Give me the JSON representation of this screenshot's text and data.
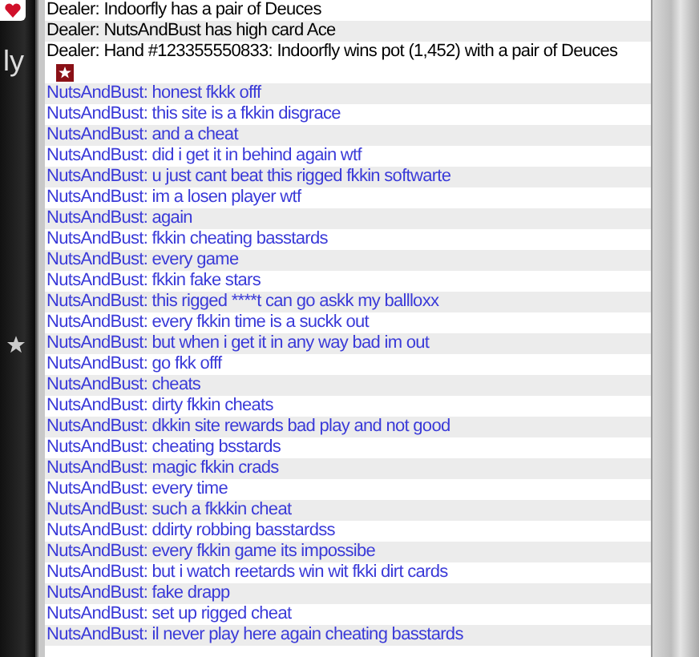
{
  "side_panel": {
    "label": "ly"
  },
  "chat": {
    "messages": [
      {
        "kind": "dealer",
        "text": "Dealer: Indoorfly has a pair of Deuces"
      },
      {
        "kind": "dealer",
        "text": "Dealer: NutsAndBust has high card Ace"
      },
      {
        "kind": "dealer",
        "text": "Dealer: Hand #123355550833: Indoorfly wins pot (1,452) with a pair of Deuces",
        "badge": true
      },
      {
        "kind": "player",
        "text": "NutsAndBust: honest fkkk offf"
      },
      {
        "kind": "player",
        "text": "NutsAndBust: this site is a fkkin disgrace"
      },
      {
        "kind": "player",
        "text": "NutsAndBust: and a  cheat"
      },
      {
        "kind": "player",
        "text": "NutsAndBust: did i get it in behind again wtf"
      },
      {
        "kind": "player",
        "text": "NutsAndBust: u just cant beat this rigged fkkin softwarte"
      },
      {
        "kind": "player",
        "text": "NutsAndBust: im  a losen player wtf"
      },
      {
        "kind": "player",
        "text": "NutsAndBust: again"
      },
      {
        "kind": "player",
        "text": "NutsAndBust: fkkin cheating basstards"
      },
      {
        "kind": "player",
        "text": "NutsAndBust: every game"
      },
      {
        "kind": "player",
        "text": "NutsAndBust: fkkin fake stars"
      },
      {
        "kind": "player",
        "text": "NutsAndBust: this rigged ****t can go askk my ballloxx"
      },
      {
        "kind": "player",
        "text": "NutsAndBust: every fkkin time is a suckk out"
      },
      {
        "kind": "player",
        "text": "NutsAndBust: but when i get it in any way bad im out"
      },
      {
        "kind": "player",
        "text": "NutsAndBust: go fkk offf"
      },
      {
        "kind": "player",
        "text": "NutsAndBust: cheats"
      },
      {
        "kind": "player",
        "text": "NutsAndBust: dirty fkkin cheats"
      },
      {
        "kind": "player",
        "text": "NutsAndBust: dkkin site rewards bad play and not good"
      },
      {
        "kind": "player",
        "text": "NutsAndBust: cheating bsstards"
      },
      {
        "kind": "player",
        "text": "NutsAndBust: magic fkkin crads"
      },
      {
        "kind": "player",
        "text": "NutsAndBust: every time"
      },
      {
        "kind": "player",
        "text": "NutsAndBust: such a fkkkin cheat"
      },
      {
        "kind": "player",
        "text": "NutsAndBust: ddirty robbing basstardss"
      },
      {
        "kind": "player",
        "text": "NutsAndBust: every fkkin game its impossibe"
      },
      {
        "kind": "player",
        "text": "NutsAndBust: but i watch reetards win wit fkki  dirt cards"
      },
      {
        "kind": "player",
        "text": "NutsAndBust: fake drapp"
      },
      {
        "kind": "player",
        "text": "NutsAndBust: set up rigged cheat"
      },
      {
        "kind": "player",
        "text": "NutsAndBust: il never play here again cheating basstards"
      }
    ]
  }
}
